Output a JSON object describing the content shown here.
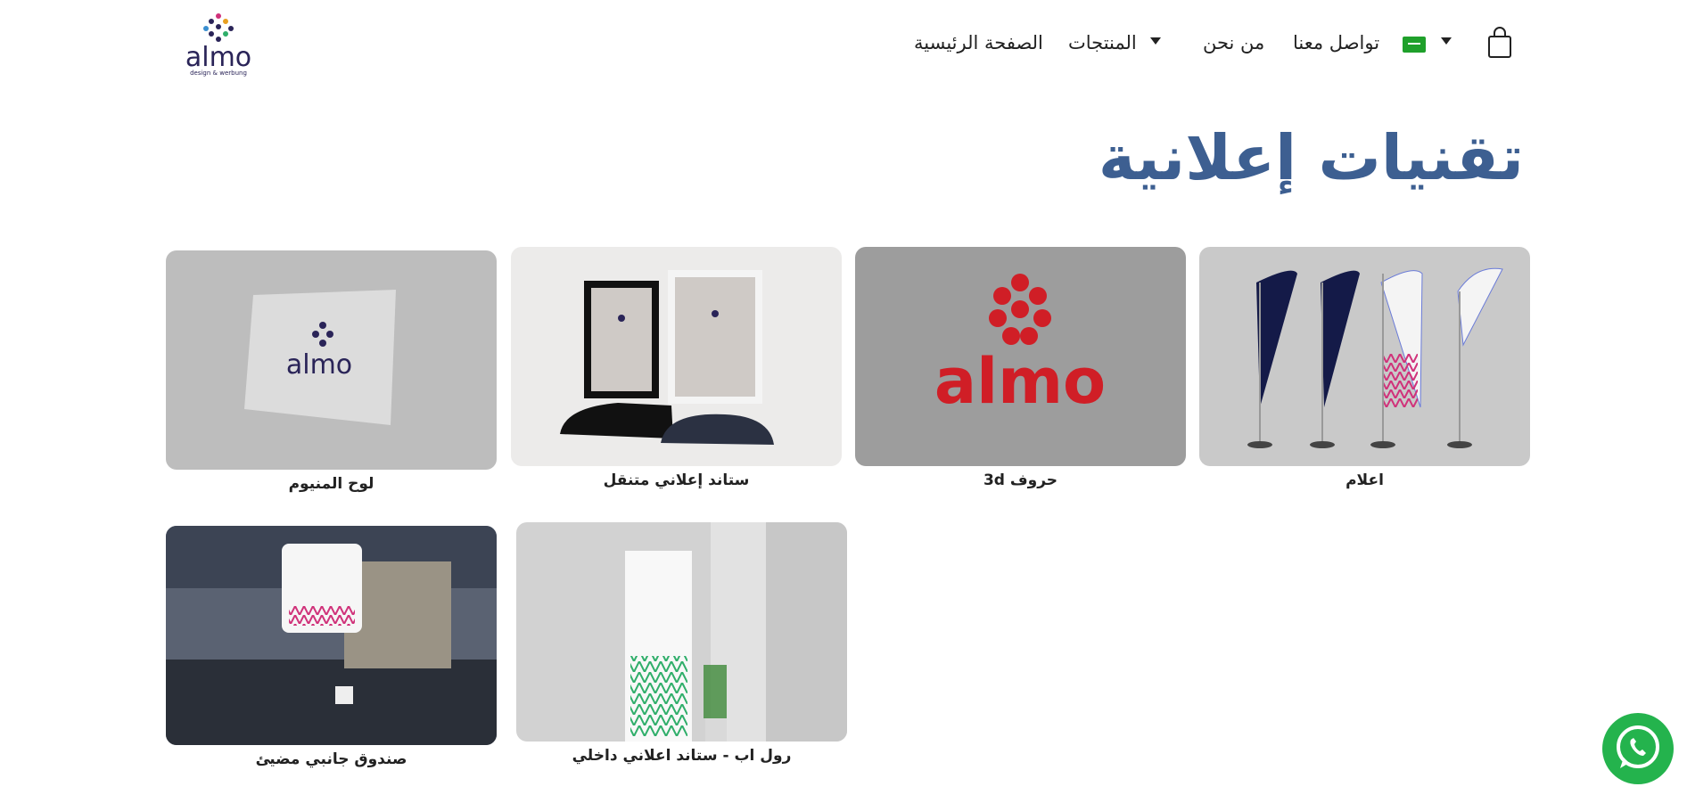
{
  "header": {
    "logo_text": "almo",
    "logo_sub": "design & werbung",
    "nav": {
      "home": "الصفحة الرئيسية",
      "products": "المنتجات",
      "about": "من نحن",
      "contact": "تواصل معنا"
    }
  },
  "page": {
    "title": "تقنيات إعلانية"
  },
  "products": [
    {
      "name": "اعلام"
    },
    {
      "name": "حروف 3d"
    },
    {
      "name": "ستاند إعلاني متنقل"
    },
    {
      "name": "لوح المنيوم"
    },
    {
      "name": "رول اب - ستاند اعلاني داخلي"
    },
    {
      "name": "صندوق جانبي مضيئ"
    }
  ],
  "colors": {
    "title": "#3d5f91",
    "whatsapp": "#24b34d",
    "flag": "#1fa02b"
  }
}
